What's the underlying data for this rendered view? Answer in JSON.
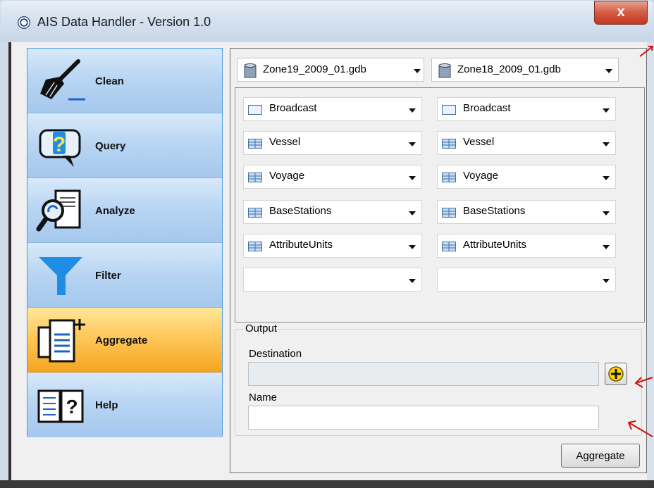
{
  "window": {
    "title": "AIS Data Handler - Version 1.0",
    "close_label": "x"
  },
  "nav": {
    "items": [
      {
        "label": "Clean",
        "icon": "broom-icon"
      },
      {
        "label": "Query",
        "icon": "question-bubble-icon"
      },
      {
        "label": "Analyze",
        "icon": "magnifier-document-icon"
      },
      {
        "label": "Filter",
        "icon": "funnel-icon"
      },
      {
        "label": "Aggregate",
        "icon": "copy-add-icon",
        "active": true
      },
      {
        "label": "Help",
        "icon": "help-book-icon"
      }
    ]
  },
  "sources": {
    "left": {
      "gdb": "Zone19_2009_01.gdb",
      "tables": [
        "Broadcast",
        "Vessel",
        "Voyage",
        "BaseStations",
        "AttributeUnits",
        ""
      ]
    },
    "right": {
      "gdb": "Zone18_2009_01.gdb",
      "tables": [
        "Broadcast",
        "Vessel",
        "Voyage",
        "BaseStations",
        "AttributeUnits",
        ""
      ]
    }
  },
  "output": {
    "legend": "Output",
    "destination_label": "Destination",
    "destination_value": "",
    "name_label": "Name",
    "name_value": ""
  },
  "actions": {
    "aggregate_label": "Aggregate"
  },
  "colors": {
    "active_nav": "#f4a520",
    "nav": "#b7d4f2",
    "annotation_arrow": "#d01010"
  }
}
